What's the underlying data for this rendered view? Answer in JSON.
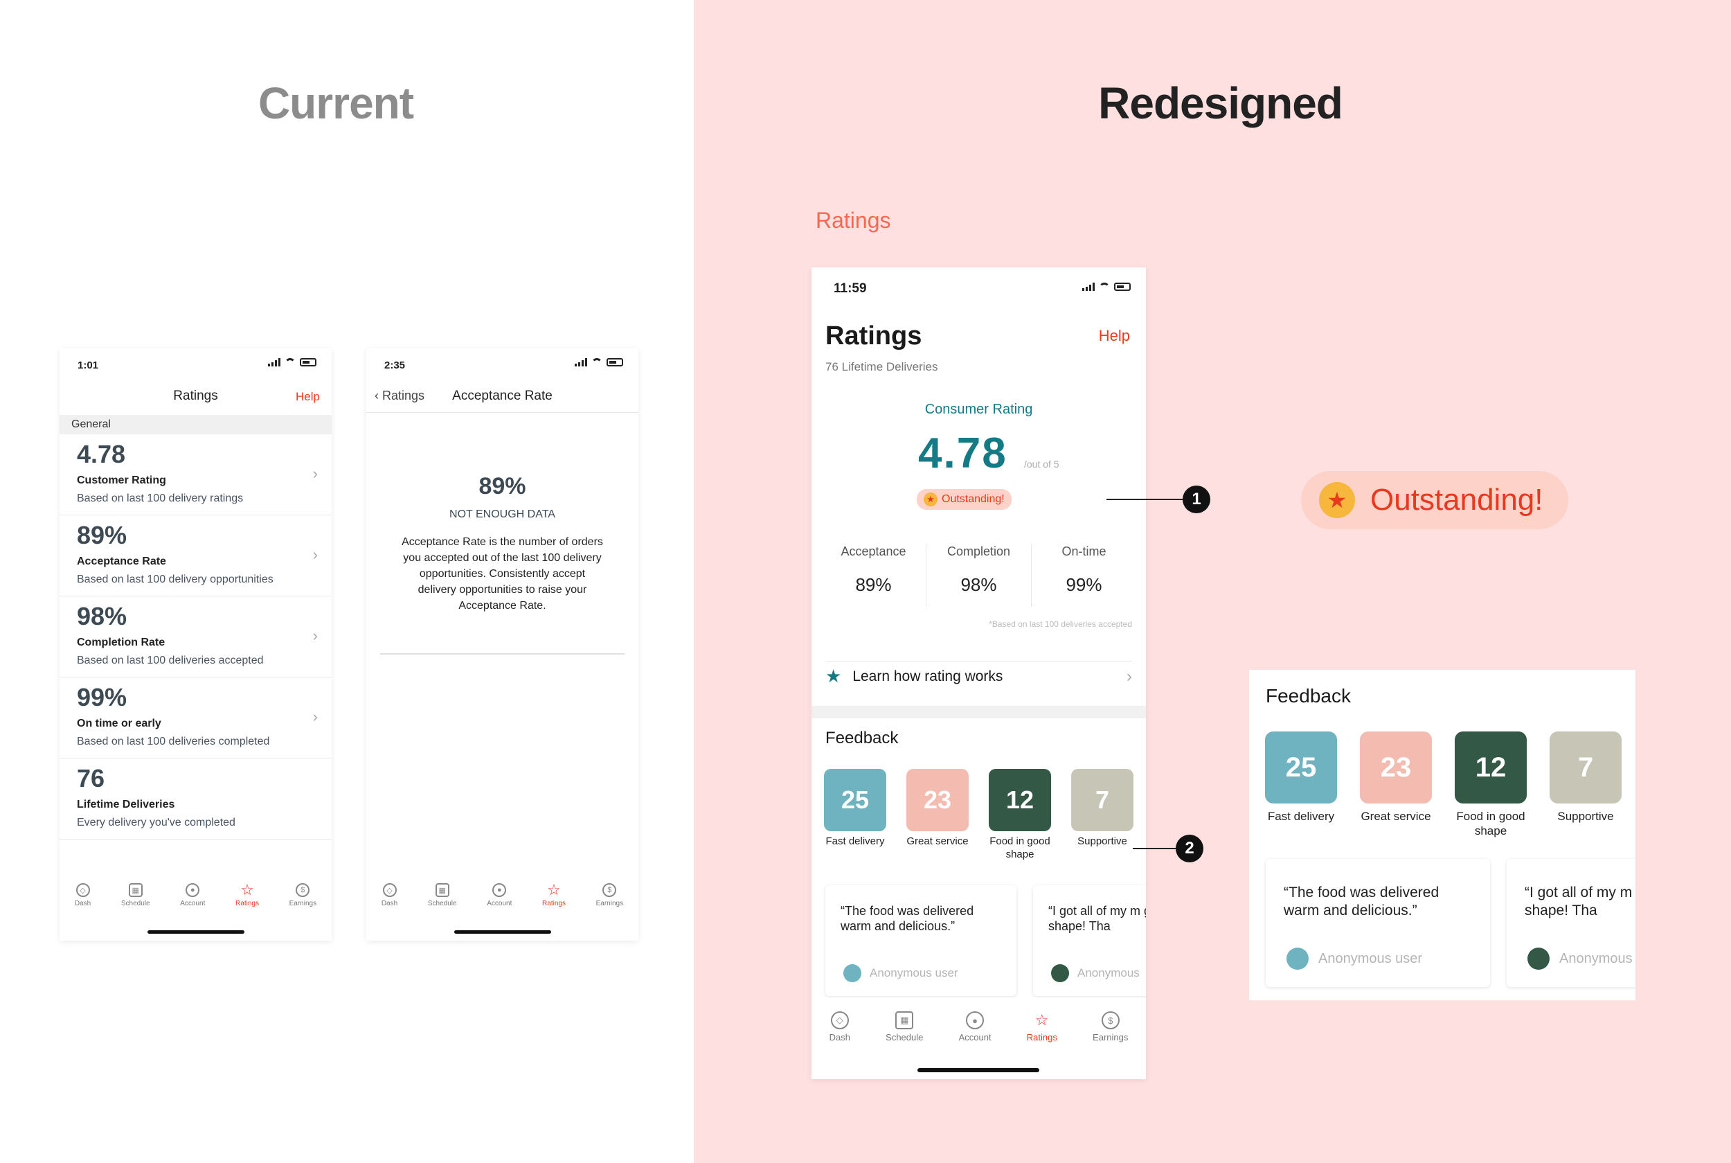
{
  "titles": {
    "current": "Current",
    "redesigned": "Redesigned",
    "ratings_label": "Ratings"
  },
  "colors": {
    "accent_red": "#e8391f",
    "teal": "#147b86",
    "salmon": "#f16a4f",
    "background_pink": "#ffe0e0"
  },
  "current_ratings": {
    "time": "1:01",
    "nav_title": "Ratings",
    "help": "Help",
    "section": "General",
    "rows": [
      {
        "value": "4.78",
        "title": "Customer Rating",
        "subtitle": "Based on last 100 delivery ratings"
      },
      {
        "value": "89%",
        "title": "Acceptance Rate",
        "subtitle": "Based on last 100 delivery opportunities"
      },
      {
        "value": "98%",
        "title": "Completion Rate",
        "subtitle": "Based on last 100 deliveries accepted"
      },
      {
        "value": "99%",
        "title": "On time or early",
        "subtitle": "Based on last 100 deliveries completed"
      },
      {
        "value": "76",
        "title": "Lifetime Deliveries",
        "subtitle": "Every delivery you've completed"
      }
    ]
  },
  "acceptance": {
    "time": "2:35",
    "back": "Ratings",
    "nav_title": "Acceptance Rate",
    "value": "89%",
    "status": "NOT ENOUGH DATA",
    "description": "Acceptance Rate is the number of orders you accepted out of the last 100 delivery opportunities. Consistently accept delivery opportunities to raise your Acceptance Rate."
  },
  "tabs": [
    {
      "label": "Dash",
      "icon": "compass-icon"
    },
    {
      "label": "Schedule",
      "icon": "calendar-icon"
    },
    {
      "label": "Account",
      "icon": "account-icon"
    },
    {
      "label": "Ratings",
      "icon": "star-icon"
    },
    {
      "label": "Earnings",
      "icon": "dollar-icon"
    }
  ],
  "redesign": {
    "time": "11:59",
    "title": "Ratings",
    "help": "Help",
    "subtitle": "76 Lifetime Deliveries",
    "consumer_label": "Consumer Rating",
    "consumer_value": "4.78",
    "consumer_suffix": "/out of 5",
    "badge": "Outstanding!",
    "stats": [
      {
        "label": "Acceptance",
        "value": "89%"
      },
      {
        "label": "Completion",
        "value": "98%"
      },
      {
        "label": "On-time",
        "value": "99%"
      }
    ],
    "footnote": "*Based on last 100 deliveries accepted",
    "learn": "Learn how rating works",
    "feedback_title": "Feedback",
    "feedback": [
      {
        "count": "25",
        "label": "Fast delivery",
        "color": "#6fb3c0"
      },
      {
        "count": "23",
        "label": "Great service",
        "color": "#f4bcb0"
      },
      {
        "count": "12",
        "label": "Food in good shape",
        "color": "#345846"
      },
      {
        "count": "7",
        "label": "Supportive",
        "color": "#c6c5b6"
      }
    ],
    "reviews": [
      {
        "quote": "“The food was delivered warm and delicious.”",
        "user": "Anonymous user",
        "dot": "#6fb3c0"
      },
      {
        "quote": "“I got all of my m good shape! Tha",
        "user": "Anonymous",
        "dot": "#345846"
      }
    ],
    "callouts": [
      "1",
      "2"
    ]
  }
}
